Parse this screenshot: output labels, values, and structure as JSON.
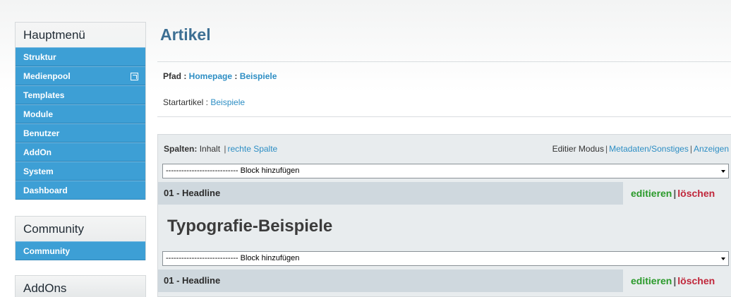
{
  "sidebar": {
    "main_menu": {
      "title": "Hauptmenü",
      "items": [
        {
          "label": "Struktur"
        },
        {
          "label": "Medienpool",
          "icon": "popup-window-icon"
        },
        {
          "label": "Templates"
        },
        {
          "label": "Module"
        },
        {
          "label": "Benutzer"
        },
        {
          "label": "AddOn"
        },
        {
          "label": "System"
        },
        {
          "label": "Dashboard"
        }
      ]
    },
    "community": {
      "title": "Community",
      "items": [
        {
          "label": "Community"
        }
      ]
    },
    "addons": {
      "title": "AddOns"
    }
  },
  "main": {
    "title": "Artikel",
    "path": {
      "label": "Pfad : ",
      "crumb1": "Homepage",
      "sep": " : ",
      "crumb2": "Beispiele"
    },
    "start": {
      "label": "Startartikel : ",
      "link": "Beispiele"
    },
    "spalten": {
      "label": "Spalten:",
      "inhalt": "Inhalt",
      "sep": "|",
      "rechte": "rechte Spalte"
    },
    "modes": {
      "edit": "Editier Modus",
      "meta": "Metadaten/Sonstiges",
      "show": "Anzeigen",
      "sep": "|"
    },
    "add_block": "---------------------------- Block hinzufügen",
    "slices": [
      {
        "name": "01 - Headline",
        "edit": "editieren",
        "sep": "|",
        "delete": "löschen",
        "content": "Typografie-Beispiele"
      },
      {
        "name": "01 - Headline",
        "edit": "editieren",
        "sep": "|",
        "delete": "löschen"
      }
    ]
  },
  "colors": {
    "accent": "#3d9fd5",
    "title": "#3d6f93",
    "link": "#2d8ec4",
    "edit": "#2a9a2a",
    "delete": "#c0263a"
  }
}
